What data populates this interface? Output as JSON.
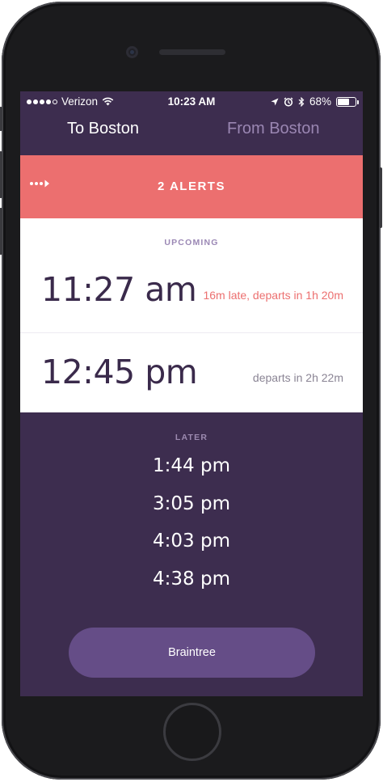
{
  "status_bar": {
    "carrier": "Verizon",
    "time": "10:23 AM",
    "battery": "68%",
    "battery_level": 0.68,
    "icons": [
      "wifi-icon",
      "location-arrow-icon",
      "alarm-icon",
      "bluetooth-icon",
      "battery-icon"
    ]
  },
  "tabs": [
    {
      "label": "To Boston",
      "active": true
    },
    {
      "label": "From Boston",
      "active": false
    }
  ],
  "alerts": {
    "label": "2 ALERTS",
    "icon": "dots-arrow-icon"
  },
  "upcoming": {
    "label": "UPCOMING",
    "trains": [
      {
        "time": "11:27 am",
        "note": "16m late, departs in 1h 20m",
        "status": "late"
      },
      {
        "time": "12:45 pm",
        "note": "departs in 2h 22m",
        "status": "on-time"
      }
    ]
  },
  "later": {
    "label": "LATER",
    "times": [
      "1:44 pm",
      "3:05 pm",
      "4:03 pm",
      "4:38 pm"
    ]
  },
  "station_button": {
    "label": "Braintree"
  },
  "colors": {
    "background": "#3d2d4f",
    "alert": "#ec6f6f",
    "button": "#654d87",
    "inactive_tab": "#9a86b2"
  }
}
